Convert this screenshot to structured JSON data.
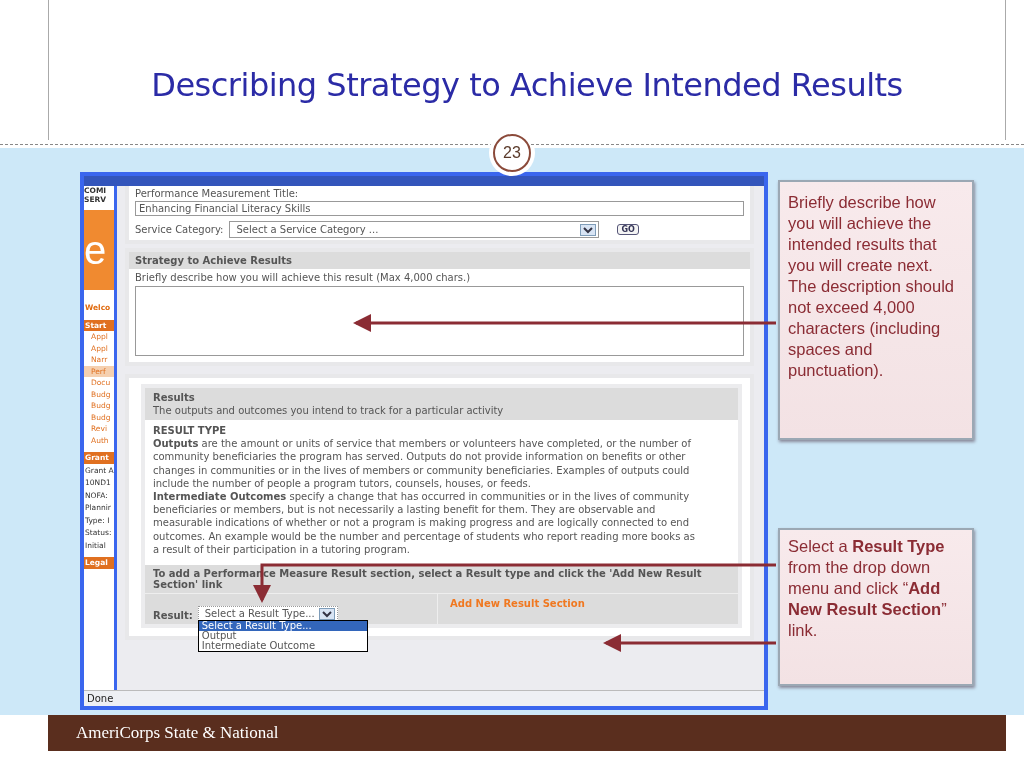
{
  "slide": {
    "title": "Describing Strategy to Achieve Intended Results",
    "page_number": "23",
    "footer": "AmeriCorps State & National"
  },
  "sidebar": {
    "top": [
      "COMI",
      "SERV"
    ],
    "logo": "e",
    "items": [
      {
        "text": "Welco",
        "kind": "welcome",
        "selected": false
      },
      {
        "text": "Start",
        "kind": "heading",
        "selected": false
      },
      {
        "text": "Appl",
        "kind": "link",
        "selected": false
      },
      {
        "text": "Appl",
        "kind": "link",
        "selected": false
      },
      {
        "text": "Narr",
        "kind": "link",
        "selected": false
      },
      {
        "text": "Perf",
        "kind": "link",
        "selected": true
      },
      {
        "text": "Docu",
        "kind": "link",
        "selected": false
      },
      {
        "text": "Budg",
        "kind": "link",
        "selected": false
      },
      {
        "text": "Budg",
        "kind": "link",
        "selected": false
      },
      {
        "text": "Budg",
        "kind": "link",
        "selected": false
      },
      {
        "text": "Revi",
        "kind": "link",
        "selected": false
      },
      {
        "text": "Auth",
        "kind": "link",
        "selected": false
      },
      {
        "text": "Grant",
        "kind": "heading",
        "selected": false
      },
      {
        "text": "Grant A",
        "kind": "info",
        "selected": false
      },
      {
        "text": "10ND1",
        "kind": "info",
        "selected": false
      },
      {
        "text": "NOFA:",
        "kind": "info",
        "selected": false
      },
      {
        "text": "Plannir",
        "kind": "info",
        "selected": false
      },
      {
        "text": "Type: I",
        "kind": "info",
        "selected": false
      },
      {
        "text": "Status:",
        "kind": "info",
        "selected": false
      },
      {
        "text": "Initial",
        "kind": "info",
        "selected": false
      },
      {
        "text": "Legal",
        "kind": "heading",
        "selected": false
      }
    ]
  },
  "form": {
    "title_label": "Performance Measurement Title:",
    "title_value": "Enhancing Financial Literacy Skills",
    "category_label": "Service Category:",
    "category_value": "Select a Service Category ...",
    "go_button": "GO"
  },
  "strategy": {
    "heading": "Strategy to Achieve Results",
    "prompt": "Briefly describe how you will achieve this result (Max 4,000 chars.)"
  },
  "results": {
    "heading": "Results",
    "subtitle": "The outputs and outcomes you intend to track for a particular activity",
    "type_heading": "RESULT TYPE",
    "paragraphs": [
      "**Outputs** are the amount or units of service that members or volunteers have completed, or the number of community beneficiaries the program has served. Outputs do not provide information on benefits or other changes in communities or in the lives of members or community beneficiaries. Examples of outputs could include the number of people a program tutors, counsels, houses, or feeds.",
      "**Intermediate Outcomes** specify a change that has occurred in communities or in the lives of community beneficiaries or members, but is not necessarily a lasting benefit for them. They are observable and measurable indications of whether or not a program is making progress and are logically connected to end outcomes. An example would be the number and percentage of students who report reading more books as a result of their participation in a tutoring program."
    ],
    "instruction": "To add a Performance Measure Result section, select a Result type and click the 'Add New Result Section' link",
    "result_label": "Result:",
    "result_value": "Select a Result Type...",
    "options": [
      {
        "label": "Select a Result Type...",
        "selected": true
      },
      {
        "label": "Output",
        "selected": false
      },
      {
        "label": "Intermediate Outcome",
        "selected": false
      }
    ],
    "add_link": "Add New Result Section"
  },
  "status_bar": "Done",
  "callouts": [
    "Briefly describe how you will achieve the intended results that you will create next. The description should not exceed 4,000 characters (including spaces and punctuation).",
    "Select a **Result Type** from the drop down menu and click “**Add New Result Section**” link."
  ]
}
